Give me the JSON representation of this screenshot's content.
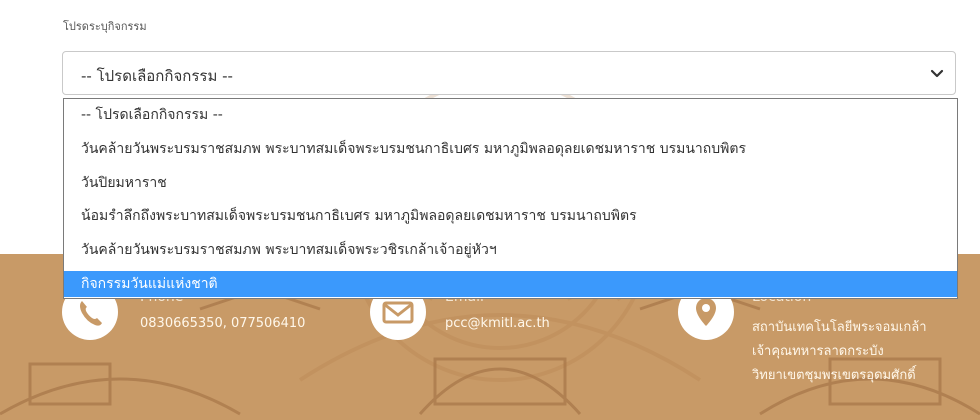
{
  "form": {
    "label": "โปรดระบุกิจกรรม",
    "select_value": "-- โปรดเลือกกิจกรรม --",
    "options": [
      "-- โปรดเลือกกิจกรรม --",
      "วันคล้ายวันพระบรมราชสมภพ พระบาทสมเด็จพระบรมชนกาธิเบศร มหาภูมิพลอดุลยเดชมหาราช บรมนาถบพิตร",
      "วันปิยมหาราช",
      "น้อมรำลึกถึงพระบาทสมเด็จพระบรมชนกาธิเบศร มหาภูมิพลอดุลยเดชมหาราช บรมนาถบพิตร",
      "วันคล้ายวันพระบรมราชสมภพ พระบาทสมเด็จพระวชิรเกล้าเจ้าอยู่หัวฯ",
      "กิจกรรมวันแม่แห่งชาติ"
    ],
    "selected_option": "กิจกรรมวันแม่แห่งชาติ"
  },
  "footer": {
    "phone": {
      "title": "Phone",
      "value": "0830665350, 077506410"
    },
    "email": {
      "title": "Email",
      "value": "pcc@kmitl.ac.th"
    },
    "location": {
      "title": "Location",
      "lines": [
        "สถาบันเทคโนโลยีพระจอมเกล้า",
        "เจ้าคุณทหารลาดกระบัง",
        "วิทยาเขตชุมพรเขตรอุดมศักดิ์"
      ]
    }
  },
  "colors": {
    "footer_bg": "#c89a67",
    "option_highlight": "#3b99fc",
    "dropdown_border": "#7a7a7a",
    "watermark": "#b07a47"
  },
  "icons": {
    "select_chevron": "chevron-down-icon",
    "phone": "phone-icon",
    "email": "envelope-icon",
    "location": "map-pin-icon"
  }
}
